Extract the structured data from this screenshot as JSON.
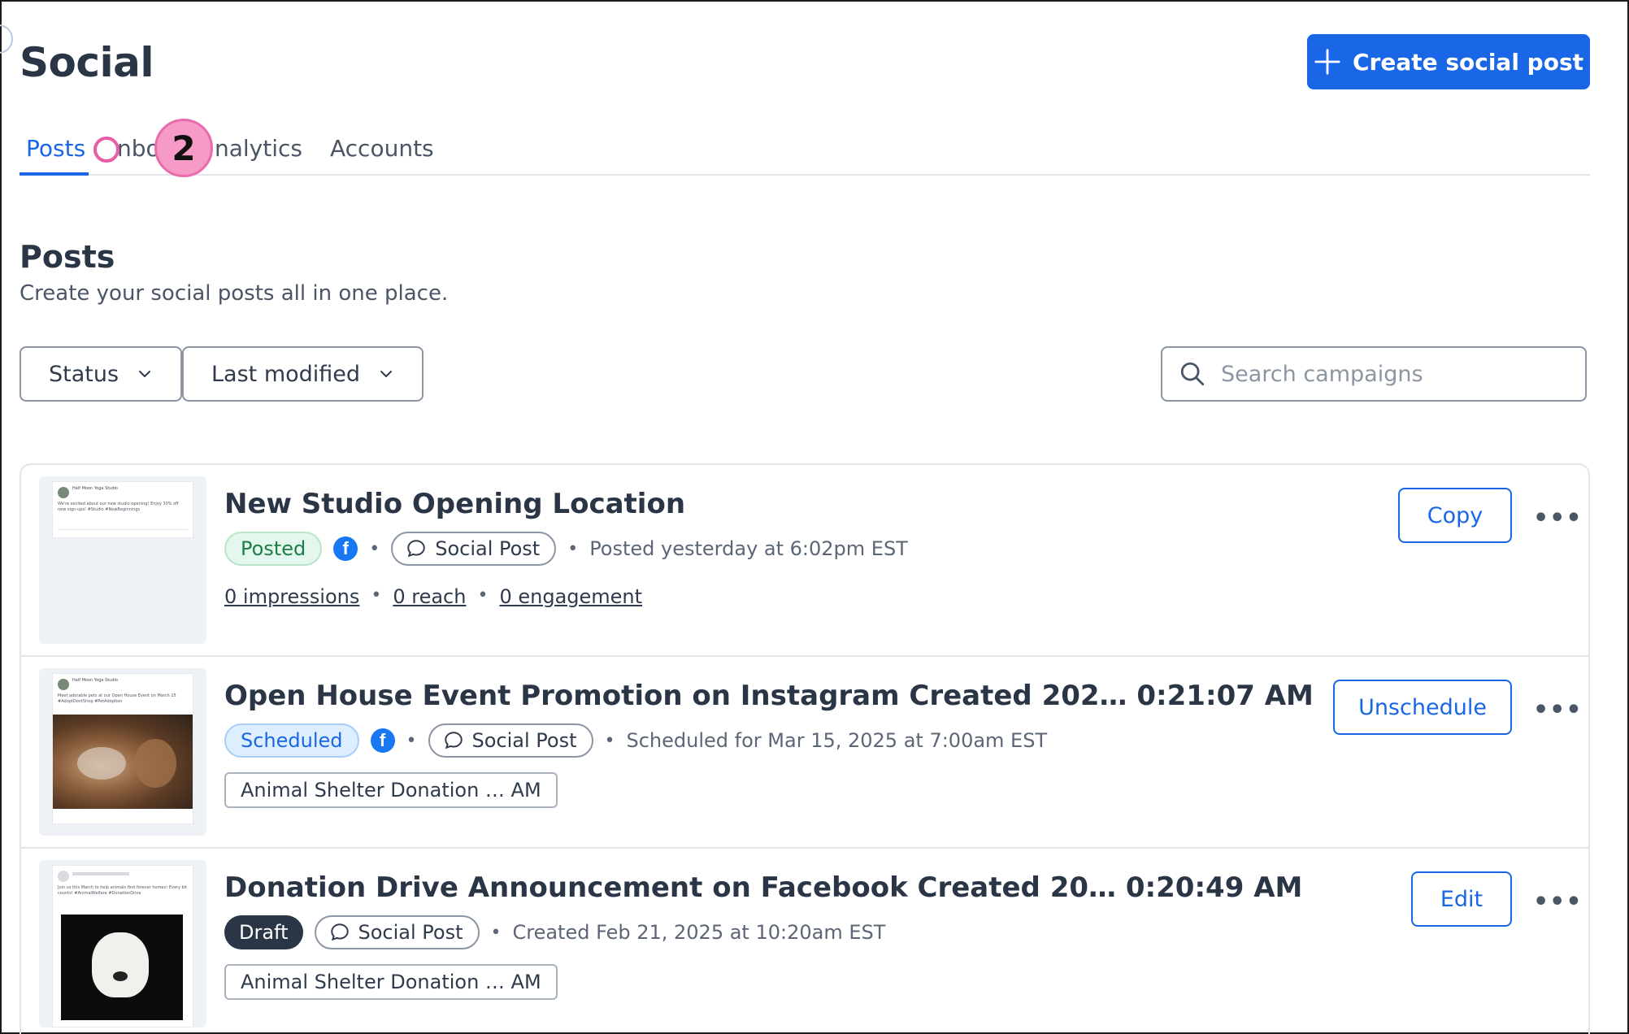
{
  "header": {
    "title": "Social",
    "create_button": "Create social post"
  },
  "tabs": [
    {
      "label": "Posts",
      "active": true
    },
    {
      "label": "Inbox",
      "active": false
    },
    {
      "label": "Analytics",
      "active": false
    },
    {
      "label": "Accounts",
      "active": false
    }
  ],
  "tabs_visible": {
    "inbox_fragment": "nbo",
    "analytics_fragment": "nalytics"
  },
  "annotation": {
    "step": "2"
  },
  "section": {
    "title": "Posts",
    "subtitle": "Create your social posts all in one place."
  },
  "filters": {
    "status": "Status",
    "last_modified": "Last modified"
  },
  "search": {
    "placeholder": "Search campaigns"
  },
  "posts": [
    {
      "title": "New Studio Opening Location",
      "status": "Posted",
      "type": "Social Post",
      "time": "Posted yesterday at 6:02pm EST",
      "stats": [
        "0 impressions",
        "0 reach",
        "0 engagement"
      ],
      "action": "Copy",
      "thumb_caption": "We're excited about our new studio opening! Enjoy 30% off new sign-ups! #Studio #NewBeginnings",
      "thumb_page": "Half Moon Yoga Studio"
    },
    {
      "title": "Open House Event Promotion on Instagram Created 202…  0:21:07 AM",
      "status": "Scheduled",
      "type": "Social Post",
      "time": "Scheduled for Mar 15, 2025 at 7:00am EST",
      "campaign": "Animal Shelter Donation …   AM",
      "action": "Unschedule",
      "thumb_caption": "Meet adorable pets at our Open House Event on March 15 #AdoptDontShop #PetAdoption",
      "thumb_page": "Half Moon Yoga Studio"
    },
    {
      "title": "Donation Drive Announcement on Facebook Created 20…  0:20:49 AM",
      "status": "Draft",
      "type": "Social Post",
      "time": "Created Feb 21, 2025 at 10:20am EST",
      "campaign": "Animal Shelter Donation …   AM",
      "action": "Edit",
      "thumb_caption": "Join us this March to help animals find forever homes! Every bit counts! #AnimalWelfare #DonationDrive"
    }
  ],
  "more_label": "•••",
  "fb_glyph": "f",
  "colors": {
    "accent": "#1967e6",
    "posted": "#1e7e4a",
    "draft": "#2a3546",
    "badge": "#f69ac8"
  }
}
